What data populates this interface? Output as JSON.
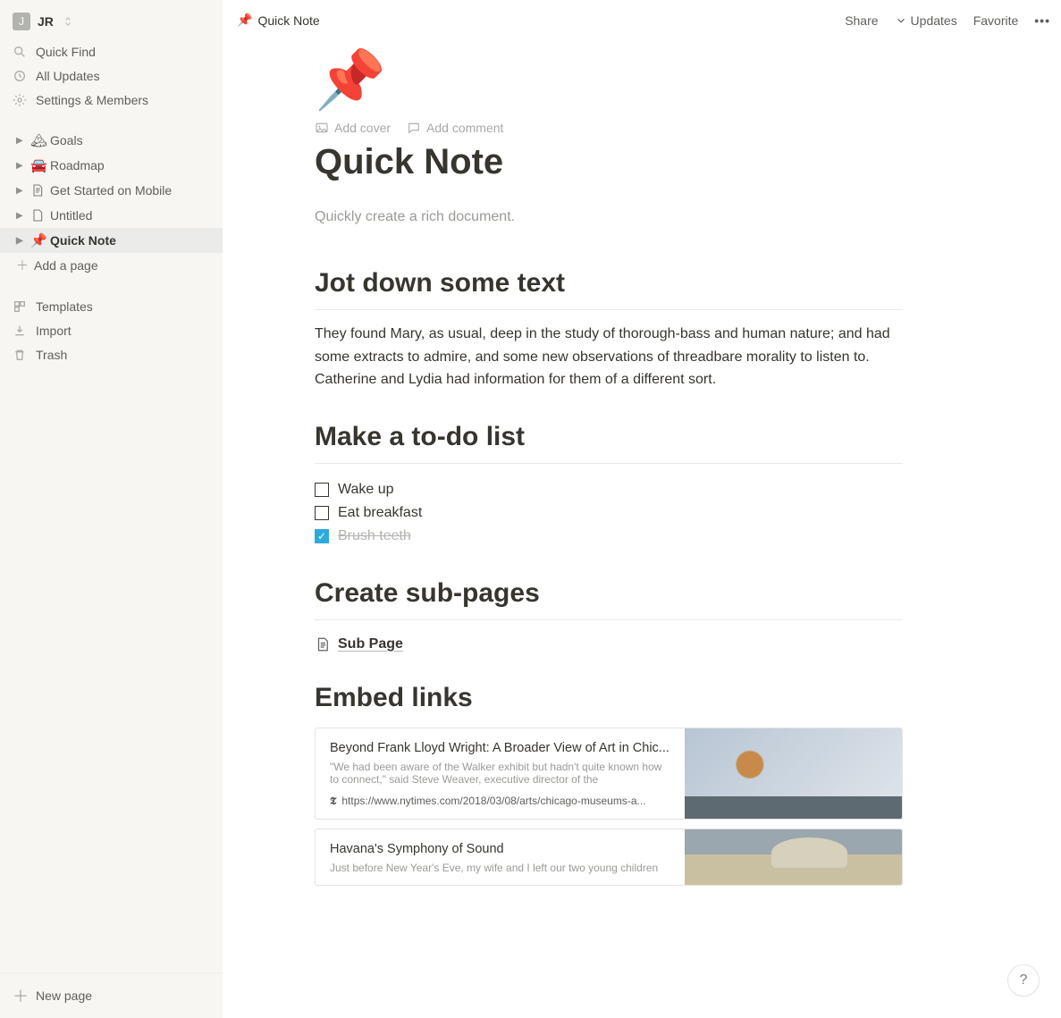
{
  "user": {
    "avatar_initial": "J",
    "name": "JR"
  },
  "sidebar": {
    "quick_find": "Quick Find",
    "all_updates": "All Updates",
    "settings": "Settings & Members",
    "pages": [
      {
        "icon": "🏔",
        "label": "Goals"
      },
      {
        "icon": "🚘",
        "label": "Roadmap"
      },
      {
        "icon": "📄",
        "label": "Get Started on Mobile"
      },
      {
        "icon": "📄",
        "label": "Untitled"
      },
      {
        "icon": "📌",
        "label": "Quick Note",
        "active": true
      }
    ],
    "add_page": "Add a page",
    "templates": "Templates",
    "import": "Import",
    "trash": "Trash",
    "new_page": "New page"
  },
  "topbar": {
    "crumb_icon": "📌",
    "crumb_title": "Quick Note",
    "share": "Share",
    "updates": "Updates",
    "favorite": "Favorite"
  },
  "page": {
    "hero_icon": "📌",
    "add_cover": "Add cover",
    "add_comment": "Add comment",
    "title": "Quick Note",
    "subtitle": "Quickly create a rich document.",
    "sections": {
      "jot": {
        "heading": "Jot down some text",
        "body": "They found Mary, as usual, deep in the study of thorough-bass and human nature; and had some extracts to admire, and some new observations of threadbare morality to listen to. Catherine and Lydia had information for them of a different sort."
      },
      "todo": {
        "heading": "Make a to-do list",
        "items": [
          {
            "label": "Wake up",
            "checked": false
          },
          {
            "label": "Eat breakfast",
            "checked": false
          },
          {
            "label": "Brush teeth",
            "checked": true
          }
        ]
      },
      "subpages": {
        "heading": "Create sub-pages",
        "item": "Sub Page"
      },
      "embed": {
        "heading": "Embed links",
        "bookmarks": [
          {
            "title": "Beyond Frank Lloyd Wright: A Broader View of Art in Chic...",
            "desc": "\"We had been aware of the Walker exhibit but hadn't quite known how to connect,\" said Steve Weaver, executive director of the",
            "favicon": "𝕿",
            "url": "https://www.nytimes.com/2018/03/08/arts/chicago-museums-a..."
          },
          {
            "title": "Havana's Symphony of Sound",
            "desc": "Just before New Year's Eve, my wife and I left our two young children",
            "favicon": "",
            "url": ""
          }
        ]
      }
    }
  },
  "help": "?"
}
